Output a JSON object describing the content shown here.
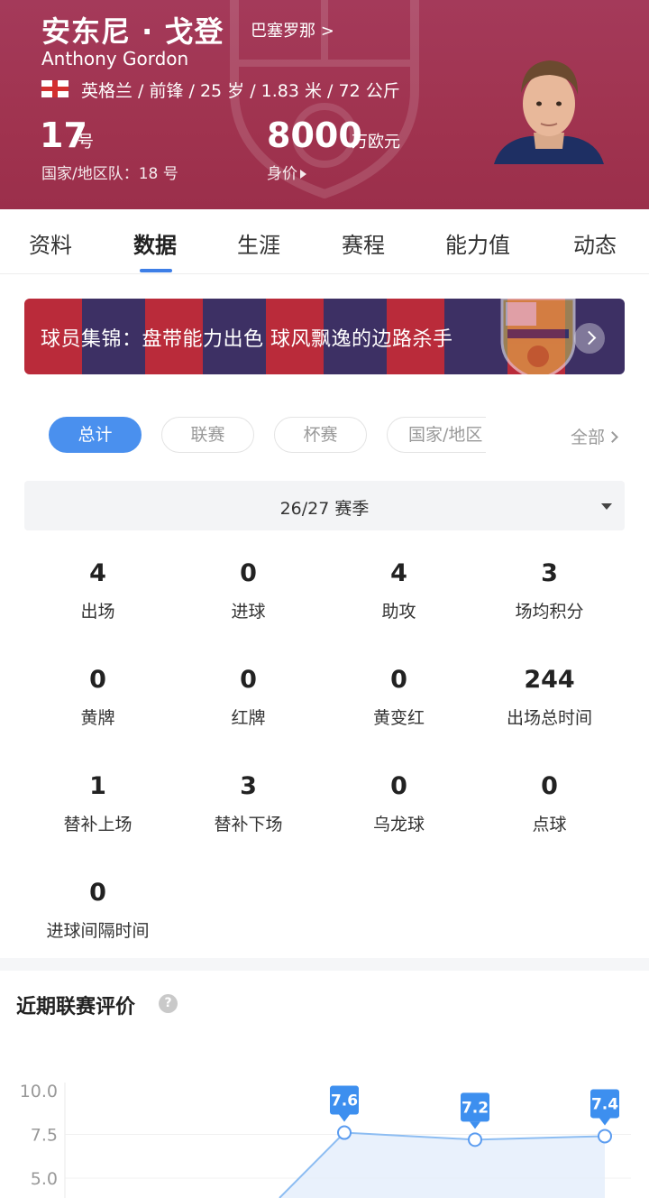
{
  "player": {
    "name_cn": "安东尼 · 戈登",
    "club": "巴塞罗那 >",
    "name_en": "Anthony Gordon",
    "info": "英格兰 / 前锋 / 25 岁 / 1.83 米 / 72 公斤",
    "number": "17",
    "number_unit": "号",
    "national_team": "国家/地区队：18 号",
    "market_value": "8000",
    "market_value_unit": "万欧元",
    "market_value_label": "身价"
  },
  "tabs": [
    {
      "label": "资料"
    },
    {
      "label": "数据"
    },
    {
      "label": "生涯"
    },
    {
      "label": "赛程"
    },
    {
      "label": "能力值"
    },
    {
      "label": "动态"
    }
  ],
  "banner": {
    "text": "球员集锦：盘带能力出色 球风飘逸的边路杀手"
  },
  "filters": [
    {
      "label": "总计",
      "active": true
    },
    {
      "label": "联赛"
    },
    {
      "label": "杯赛"
    },
    {
      "label": "国家/地区"
    }
  ],
  "filter_all": "全部",
  "season": "26/27 赛季",
  "stats": [
    {
      "value": "4",
      "label": "出场"
    },
    {
      "value": "0",
      "label": "进球"
    },
    {
      "value": "4",
      "label": "助攻"
    },
    {
      "value": "3",
      "label": "场均积分"
    },
    {
      "value": "0",
      "label": "黄牌"
    },
    {
      "value": "0",
      "label": "红牌"
    },
    {
      "value": "0",
      "label": "黄变红"
    },
    {
      "value": "244",
      "label": "出场总时间"
    },
    {
      "value": "1",
      "label": "替补上场"
    },
    {
      "value": "3",
      "label": "替补下场"
    },
    {
      "value": "0",
      "label": "乌龙球"
    },
    {
      "value": "0",
      "label": "点球"
    },
    {
      "value": "0",
      "label": "进球间隔时间"
    }
  ],
  "rating": {
    "title": "近期联赛评价",
    "help": "?"
  },
  "chart_data": {
    "type": "area",
    "y_ticks": [
      "10.0",
      "7.5",
      "5.0"
    ],
    "points": [
      {
        "value": 7.6,
        "label": "7.6"
      },
      {
        "value": 7.2,
        "label": "7.2"
      },
      {
        "value": 7.4,
        "label": "7.4"
      }
    ],
    "colors": {
      "line": "#8dbdf2",
      "fill": "#e3eefb",
      "label_bg": "#3d8fef",
      "point_stroke": "#5b9cf0"
    }
  }
}
